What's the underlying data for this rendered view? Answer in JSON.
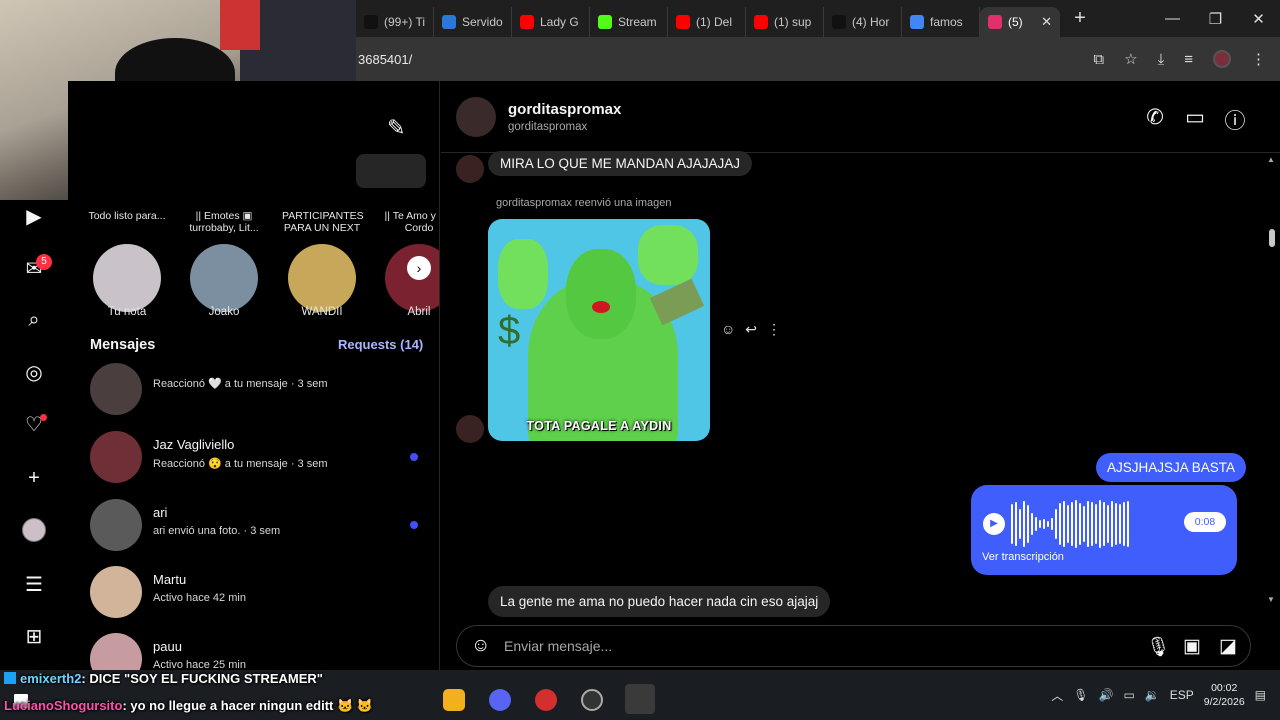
{
  "browser": {
    "tabs": [
      {
        "label": "(99+) Ti",
        "icon": "tiktok-icon",
        "color": "#111111"
      },
      {
        "label": "Servido",
        "icon": "server-icon",
        "color": "#2a79d8"
      },
      {
        "label": "Lady G",
        "icon": "youtube-icon",
        "color": "#ff0000"
      },
      {
        "label": "Stream",
        "icon": "kick-icon",
        "color": "#53fc18"
      },
      {
        "label": "(1) Del",
        "icon": "youtube-icon",
        "color": "#ff0000"
      },
      {
        "label": "(1) sup",
        "icon": "youtube-icon",
        "color": "#ff0000"
      },
      {
        "label": "(4) Hor",
        "icon": "x-icon",
        "color": "#111111"
      },
      {
        "label": "famos",
        "icon": "google-icon",
        "color": "#4285f4"
      },
      {
        "label": "(5)",
        "icon": "instagram-icon",
        "color": "#e1306c",
        "active": true
      }
    ],
    "url": "3685401/",
    "new_tab": "+",
    "win_min": "—",
    "win_max": "❐",
    "win_close": "✕"
  },
  "rail": {
    "notification_count": "5"
  },
  "list": {
    "notes": [
      {
        "bubble": "Todo listo para...",
        "name": "Tu nota",
        "color": "#c9c2c8"
      },
      {
        "bubble": "|| Emotes ▣ turrobaby, Lit...",
        "name": "Joako",
        "color": "#7c8fa0"
      },
      {
        "bubble": "PARTICIPANTES PARA UN NEXT",
        "name": "WANDII",
        "color": "#c7a85a"
      },
      {
        "bubble": "|| Te Amo y Ian Cordo",
        "name": "Abril",
        "color": "#7a2230"
      }
    ],
    "title": "Mensajes",
    "requests": "Requests (14)",
    "conversations": [
      {
        "name": "",
        "preview": "Reaccionó 🤍 a tu mensaje · 3 sem",
        "unread": false,
        "color": "#4a3e3e"
      },
      {
        "name": "Jaz Vagliviello",
        "preview": "Reaccionó 😯 a tu mensaje · 3 sem",
        "unread": true,
        "color": "#6e2f36"
      },
      {
        "name": "ari",
        "preview": "ari envió una foto. · 3 sem",
        "unread": true,
        "color": "#5a5a5a"
      },
      {
        "name": "Martu",
        "preview": "Activo hace 42 min",
        "unread": false,
        "color": "#d2b49a"
      },
      {
        "name": "pauu",
        "preview": "Activo hace 25 min",
        "unread": false,
        "color": "#c79ca0"
      }
    ]
  },
  "chat": {
    "name": "gorditaspromax",
    "username": "gorditaspromax",
    "msg1": "MIRA LO QUE ME MANDAN AJAJAJAJ",
    "forward_label": "gorditaspromax reenvió una imagen",
    "meme_caption": "TOTA PAGALE A AYDIN",
    "out_msg": "AJSJHAJSJA BASTA",
    "voice_duration": "0:08",
    "voice_transcript": "Ver transcripción",
    "last_msg": "La gente me ama no puedo hacer nada cin eso ajajaj",
    "composer_placeholder": "Enviar mensaje..."
  },
  "stream_chat": [
    {
      "user": "emixerth2",
      "text": ": DICE \"SOY EL FUCKING STREAMER\""
    },
    {
      "user": "LucianoShogursito",
      "text": ": yo no llegue a hacer ningun editt 🐱 🐱"
    }
  ],
  "taskbar": {
    "lang": "ESP",
    "time": "00:02",
    "date": "9/2/2026"
  }
}
